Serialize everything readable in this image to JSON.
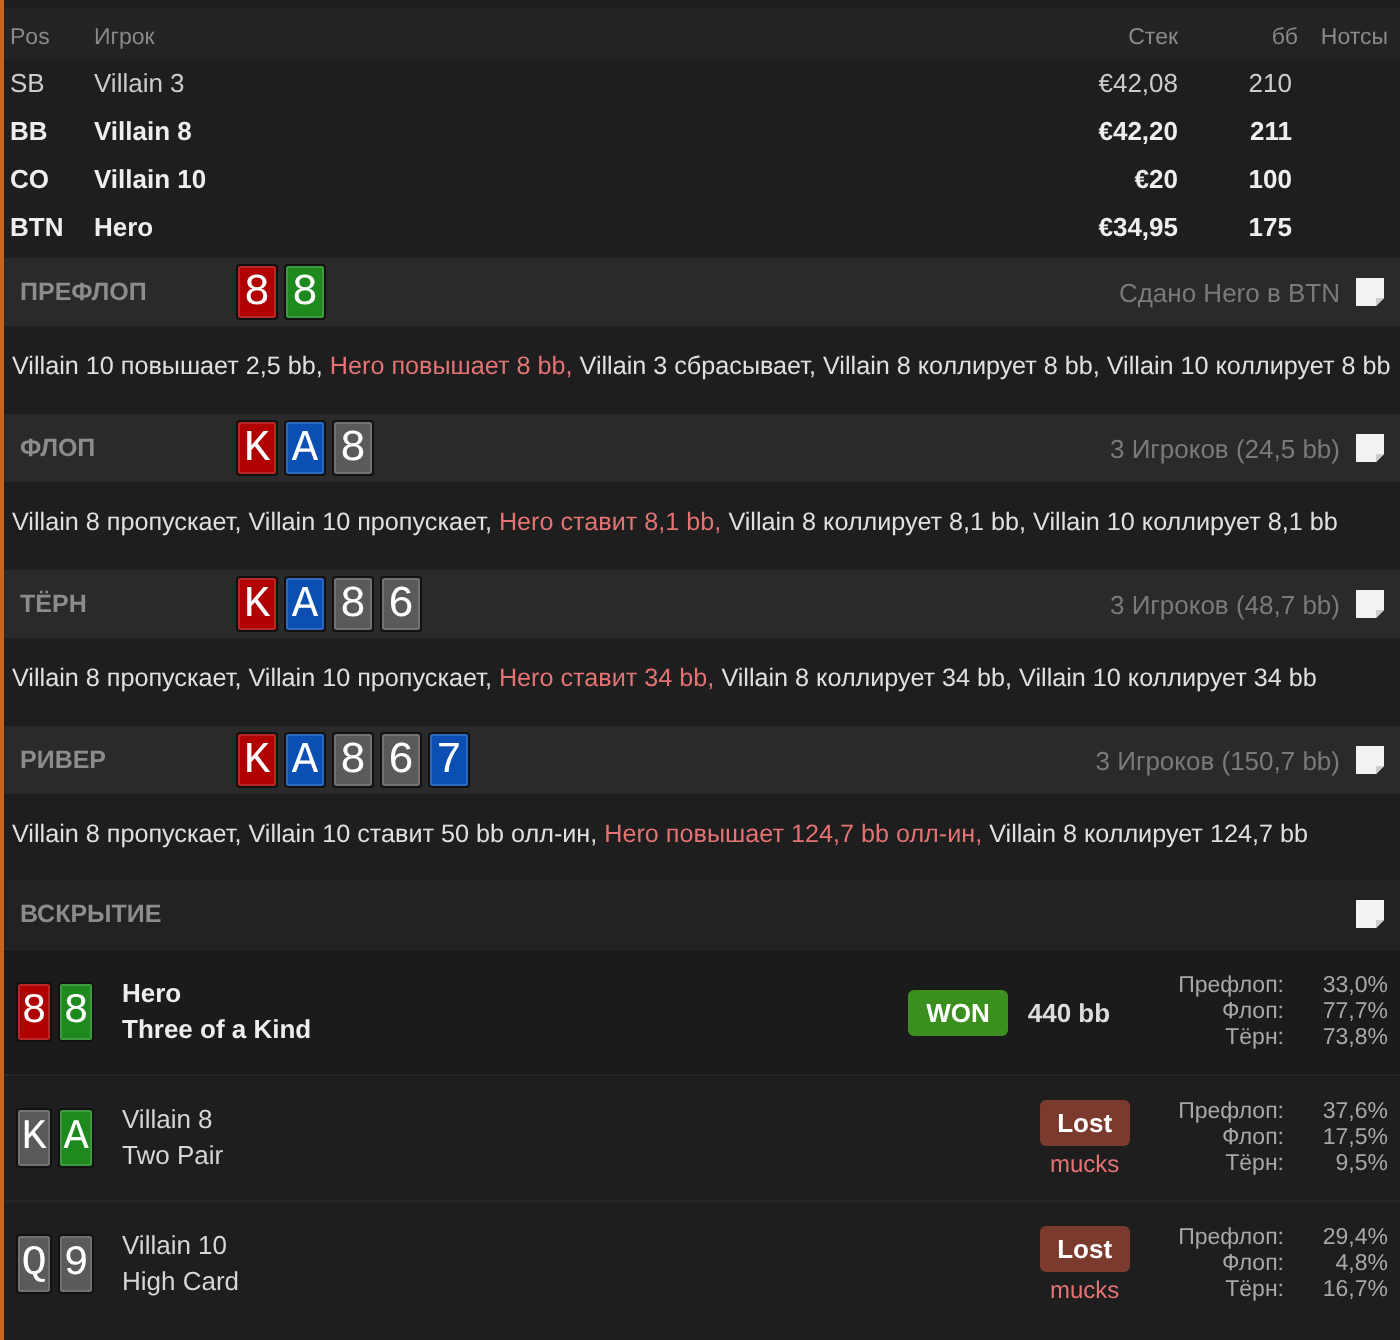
{
  "players_table": {
    "columns": [
      "Pos",
      "Игрок",
      "Стек",
      "бб",
      "Нотсы"
    ],
    "rows": [
      {
        "pos": "SB",
        "name": "Villain 3",
        "stack": "€42,08",
        "bb": "210",
        "in_hand": false
      },
      {
        "pos": "BB",
        "name": "Villain 8",
        "stack": "€42,20",
        "bb": "211",
        "in_hand": true
      },
      {
        "pos": "CO",
        "name": "Villain 10",
        "stack": "€20",
        "bb": "100",
        "in_hand": true
      },
      {
        "pos": "BTN",
        "name": "Hero",
        "stack": "€34,95",
        "bb": "175",
        "in_hand": true
      }
    ]
  },
  "streets": [
    {
      "name": "ПРЕФЛОП",
      "cards": [
        {
          "rank": "8",
          "color": "#b00000"
        },
        {
          "rank": "8",
          "color": "#1e8a1e"
        }
      ],
      "info": "Сдано Hero в BTN",
      "note": false,
      "actions": [
        {
          "text": "Villain 10 повышает 2,5 bb,",
          "hero": false
        },
        {
          "text": "Hero повышает 8 bb,",
          "hero": true
        },
        {
          "text": "Villain 3 сбрасывает, Villain 8 коллирует 8 bb, Villain 10 коллирует 8 bb",
          "hero": false
        }
      ]
    },
    {
      "name": "ФЛОП",
      "cards": [
        {
          "rank": "K",
          "color": "#b00000"
        },
        {
          "rank": "A",
          "color": "#0b4fb3"
        },
        {
          "rank": "8",
          "color": "#5a5a5a"
        }
      ],
      "info": "3 Игроков (24,5 bb)",
      "note": false,
      "actions": [
        {
          "text": "Villain 8 пропускает, Villain 10 пропускает,",
          "hero": false
        },
        {
          "text": "Hero ставит 8,1 bb,",
          "hero": true
        },
        {
          "text": "Villain 8 коллирует 8,1 bb, Villain 10 коллирует 8,1 bb",
          "hero": false
        }
      ]
    },
    {
      "name": "ТЁРН",
      "cards": [
        {
          "rank": "K",
          "color": "#b00000"
        },
        {
          "rank": "A",
          "color": "#0b4fb3"
        },
        {
          "rank": "8",
          "color": "#5a5a5a"
        },
        {
          "rank": "6",
          "color": "#5a5a5a"
        }
      ],
      "info": "3 Игроков (48,7 bb)",
      "note": false,
      "actions": [
        {
          "text": "Villain 8 пропускает, Villain 10 пропускает,",
          "hero": false
        },
        {
          "text": "Hero ставит 34 bb,",
          "hero": true
        },
        {
          "text": "Villain 8 коллирует 34 bb, Villain 10 коллирует 34 bb",
          "hero": false
        }
      ]
    },
    {
      "name": "РИВЕР",
      "cards": [
        {
          "rank": "K",
          "color": "#b00000"
        },
        {
          "rank": "A",
          "color": "#0b4fb3"
        },
        {
          "rank": "8",
          "color": "#5a5a5a"
        },
        {
          "rank": "6",
          "color": "#5a5a5a"
        },
        {
          "rank": "7",
          "color": "#0b4fb3"
        }
      ],
      "info": "3 Игроков (150,7 bb)",
      "note": false,
      "actions": [
        {
          "text": "Villain 8 пропускает, Villain 10 ставит 50 bb олл-ин,",
          "hero": false
        },
        {
          "text": "Hero повышает 124,7 bb олл-ин,",
          "hero": true
        },
        {
          "text": "Villain 8 коллирует 124,7 bb",
          "hero": false
        }
      ]
    }
  ],
  "showdown": {
    "title": "ВСКРЫТИЕ",
    "note": false,
    "players": [
      {
        "cards": [
          {
            "rank": "8",
            "color": "#b00000"
          },
          {
            "rank": "8",
            "color": "#1e8a1e"
          }
        ],
        "name": "Hero",
        "hand": "Three of a Kind",
        "is_hero": true,
        "result": {
          "kind": "won",
          "label": "WON",
          "amount": "440 bb"
        },
        "equity": [
          {
            "label": "Префлоп:",
            "value": "33,0%"
          },
          {
            "label": "Флоп:",
            "value": "77,7%"
          },
          {
            "label": "Тёрн:",
            "value": "73,8%"
          }
        ]
      },
      {
        "cards": [
          {
            "rank": "K",
            "color": "#5a5a5a"
          },
          {
            "rank": "A",
            "color": "#1e8a1e"
          }
        ],
        "name": "Villain 8",
        "hand": "Two Pair",
        "is_hero": false,
        "result": {
          "kind": "lost",
          "label": "Lost",
          "sub": "mucks"
        },
        "equity": [
          {
            "label": "Префлоп:",
            "value": "37,6%"
          },
          {
            "label": "Флоп:",
            "value": "17,5%"
          },
          {
            "label": "Тёрн:",
            "value": "9,5%"
          }
        ]
      },
      {
        "cards": [
          {
            "rank": "Q",
            "color": "#5a5a5a"
          },
          {
            "rank": "9",
            "color": "#5a5a5a"
          }
        ],
        "name": "Villain 10",
        "hand": "High Card",
        "is_hero": false,
        "result": {
          "kind": "lost",
          "label": "Lost",
          "sub": "mucks"
        },
        "equity": [
          {
            "label": "Префлоп:",
            "value": "29,4%"
          },
          {
            "label": "Флоп:",
            "value": "4,8%"
          },
          {
            "label": "Тёрн:",
            "value": "16,7%"
          }
        ]
      }
    ]
  }
}
